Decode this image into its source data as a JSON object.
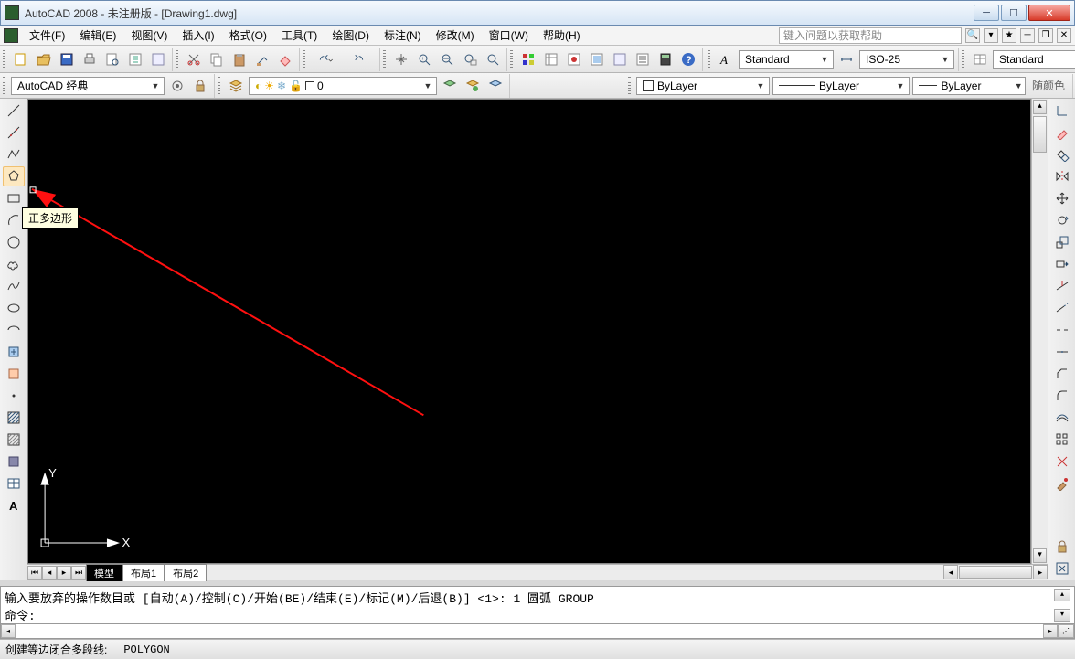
{
  "title": "AutoCAD 2008 - 未注册版 - [Drawing1.dwg]",
  "menus": [
    "文件(F)",
    "编辑(E)",
    "视图(V)",
    "插入(I)",
    "格式(O)",
    "工具(T)",
    "绘图(D)",
    "标注(N)",
    "修改(M)",
    "窗口(W)",
    "帮助(H)"
  ],
  "help_placeholder": "键入问题以获取帮助",
  "workspace": "AutoCAD 经典",
  "layer_value": "0",
  "text_style": "Standard",
  "dim_style": "ISO-25",
  "table_style": "Standard",
  "color_value": "ByLayer",
  "linetype_value": "ByLayer",
  "lineweight_value": "ByLayer",
  "color_extra": "随颜色",
  "tabs": {
    "model": "模型",
    "layout1": "布局1",
    "layout2": "布局2"
  },
  "tooltip": "正多边形",
  "axis": {
    "y": "Y",
    "x": "X"
  },
  "cmd_line1": "输入要放弃的操作数目或 [自动(A)/控制(C)/开始(BE)/结束(E)/标记(M)/后退(B)] <1>: 1 圆弧  GROUP",
  "cmd_line2": "命令:",
  "status_text": "创建等边闭合多段线:",
  "status_cmd": "POLYGON",
  "left_tools": [
    "line",
    "construction-line",
    "polyline",
    "polygon",
    "rectangle",
    "arc",
    "circle",
    "revision-cloud",
    "spline",
    "ellipse",
    "ellipse-arc",
    "insert-block",
    "make-block",
    "point",
    "hatch",
    "gradient",
    "region",
    "table",
    "text"
  ],
  "right_tools": [
    "ucs",
    "pan",
    "distance",
    "constraint",
    "move",
    "rotate",
    "trim",
    "scale",
    "mirror",
    "offset",
    "array",
    "stretch",
    "fillet",
    "chamfer",
    "break",
    "join",
    "explode",
    "paint"
  ],
  "std_tools": [
    "new",
    "open",
    "save",
    "print",
    "preview",
    "publish",
    "cut",
    "copy",
    "paste",
    "match",
    "undo",
    "redo",
    "pan-rt",
    "zoom-prev",
    "zoom-rt",
    "zoom-win",
    "zoom-all",
    "tool-palettes",
    "sheet-set",
    "markup",
    "qcalc",
    "help"
  ],
  "layer_tools": [
    "layer-mgr",
    "freeze",
    "on",
    "lock"
  ],
  "prop_tools": [
    "properties",
    "layers",
    "filters"
  ]
}
